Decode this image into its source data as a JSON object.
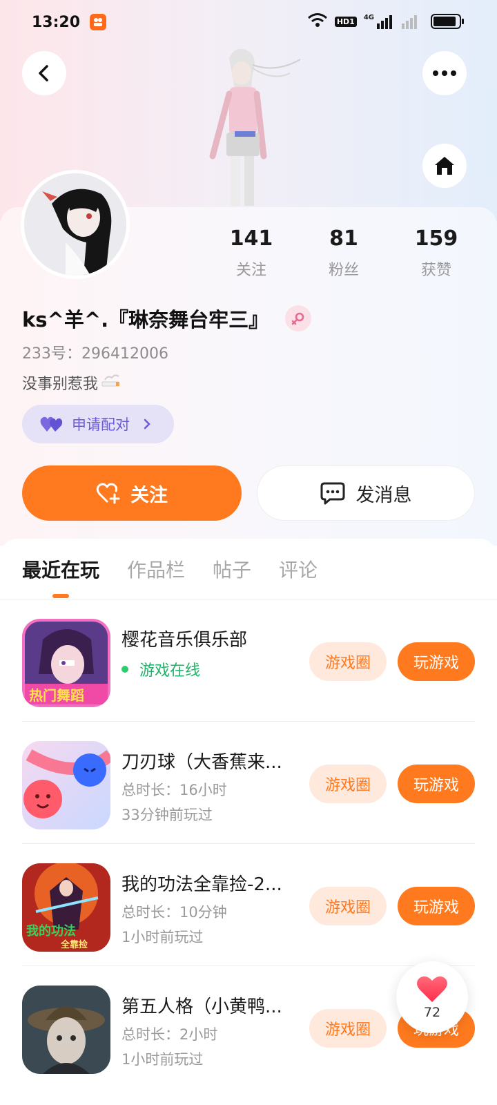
{
  "status_bar": {
    "time": "13:20",
    "network": "4G",
    "hd_label": "HD1",
    "battery_level": 0.9,
    "icons": [
      "app-notification-icon",
      "wifi-icon",
      "signal-icon",
      "battery-icon"
    ]
  },
  "header": {
    "icons": [
      "back-icon",
      "more-icon",
      "home-icon"
    ]
  },
  "profile": {
    "stats": [
      {
        "value": "141",
        "label": "关注"
      },
      {
        "value": "81",
        "label": "粉丝"
      },
      {
        "value": "159",
        "label": "获赞"
      }
    ],
    "username": "ks^羊^.『琳奈舞台牢三』",
    "uid": "233号：296412006",
    "bio": "没事别惹我",
    "pair_button": "申请配对",
    "follow_button": "关注",
    "message_button": "发消息"
  },
  "tabs": [
    "最近在玩",
    "作品栏",
    "帖子",
    "评论"
  ],
  "active_tab": "最近在玩",
  "games": [
    {
      "name": "樱花音乐俱乐部",
      "status": "游戏在线",
      "circle_label": "游戏圈",
      "play_label": "玩游戏"
    },
    {
      "name": "刀刃球（大香蕉来...",
      "duration": "总时长：16小时",
      "last_played": "33分钟前玩过",
      "circle_label": "游戏圈",
      "play_label": "玩游戏"
    },
    {
      "name": "我的功法全靠捡-2...",
      "duration": "总时长：10分钟",
      "last_played": "1小时前玩过",
      "circle_label": "游戏圈",
      "play_label": "玩游戏"
    },
    {
      "name": "第五人格（小黄鸭...",
      "duration": "总时长：2小时",
      "last_played": "1小时前玩过",
      "circle_label": "游戏圈",
      "play_label": "玩游戏"
    }
  ],
  "like_float": {
    "count": "72"
  },
  "colors": {
    "accent": "#ff7a1e",
    "online": "#22b36a",
    "pair": "#6a5bd6"
  }
}
